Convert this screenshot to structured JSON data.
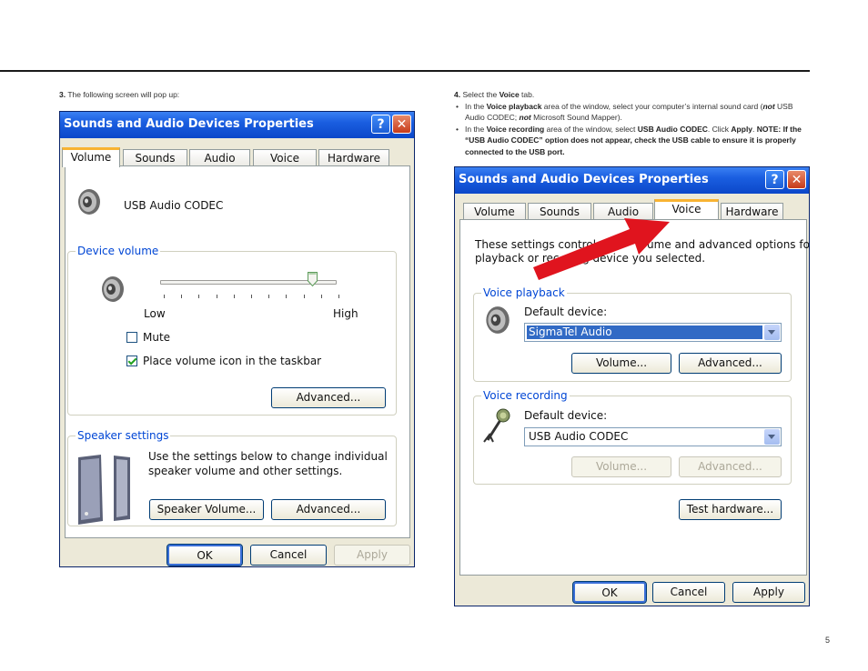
{
  "page": {
    "number": "5"
  },
  "step3": {
    "num": "3.",
    "text": "The following screen will pop up:"
  },
  "step4": {
    "num": "4.",
    "t1": "Select the ",
    "b1": "Voice",
    "t2": " tab.",
    "bullet1": {
      "t1": "In the ",
      "b1": "Voice playback",
      "t2": " area of the window, select your computer’s internal sound card (",
      "b2": "not",
      "t3": " USB Audio CODEC; ",
      "b3": "not",
      "t4": " Microsoft Sound Mapper)."
    },
    "bullet2": {
      "t1": "In the ",
      "b1": "Voice recording",
      "t2": " area of the window, select ",
      "b2": "USB Audio CODEC",
      "t3": ". Click ",
      "b3": "Apply",
      "t4": ".",
      "note": "NOTE: If the “USB Audio CODEC” option does not appear, check the USB cable to ensure it is properly connected to the USB port."
    }
  },
  "dialog_left": {
    "title": "Sounds and Audio Devices Properties",
    "help": "?",
    "close": "✕",
    "tabs": [
      "Volume",
      "Sounds",
      "Audio",
      "Voice",
      "Hardware"
    ],
    "device_name": "USB Audio CODEC",
    "device_volume": {
      "label": "Device volume",
      "low": "Low",
      "high": "High",
      "level": 0.85
    },
    "mute": {
      "label": "Mute",
      "checked": false
    },
    "taskbar": {
      "label": "Place volume icon in the taskbar",
      "checked": true
    },
    "advanced1": "Advanced...",
    "speaker": {
      "label": "Speaker settings",
      "line1": "Use the settings below to change individual",
      "line2": "speaker volume and other settings.",
      "volume_btn": "Speaker Volume...",
      "advanced_btn": "Advanced..."
    },
    "ok": "OK",
    "cancel": "Cancel",
    "apply": "Apply"
  },
  "dialog_right": {
    "title": "Sounds and Audio Devices Properties",
    "help": "?",
    "close": "✕",
    "tabs": [
      "Volume",
      "Sounds",
      "Audio",
      "Voice",
      "Hardware"
    ],
    "intro1": "These settings control",
    "intro1b": "ume and advanced options for the voice",
    "intro2": "playback or rec",
    "intro2b": "ng device you selected.",
    "playback": {
      "label": "Voice playback",
      "default_device": "Default device:",
      "value": "SigmaTel Audio",
      "volume_btn": "Volume...",
      "advanced_btn": "Advanced..."
    },
    "recording": {
      "label": "Voice recording",
      "default_device": "Default device:",
      "value": "USB Audio CODEC",
      "volume_btn": "Volume...",
      "advanced_btn": "Advanced..."
    },
    "test_hw": "Test hardware...",
    "ok": "OK",
    "cancel": "Cancel",
    "apply": "Apply",
    "arrow_color": "#e0141e"
  }
}
